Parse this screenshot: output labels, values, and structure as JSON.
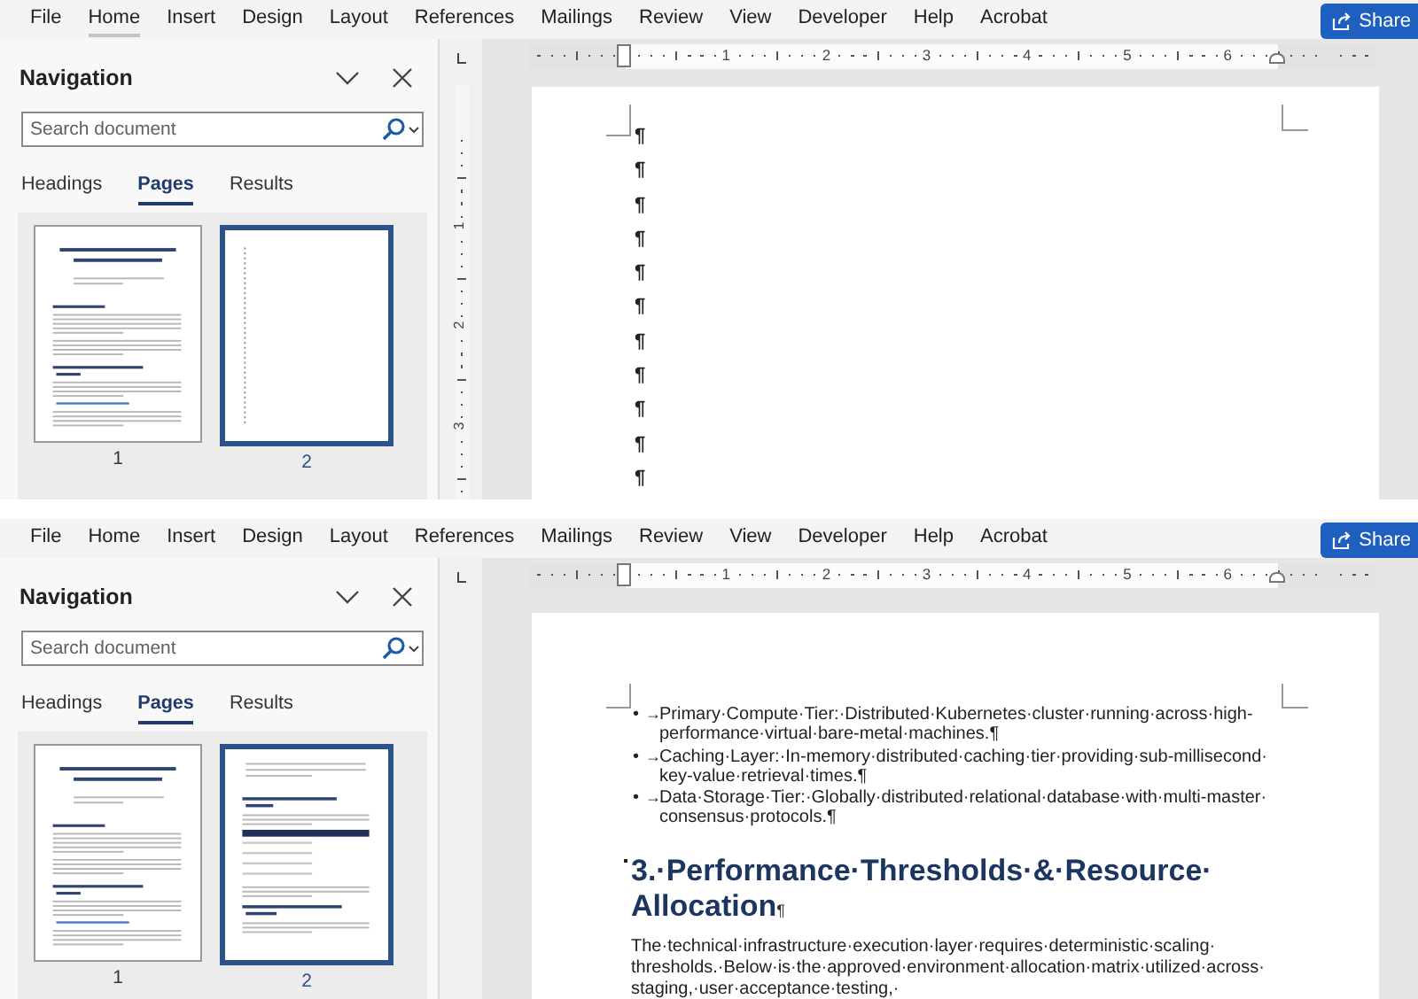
{
  "panels": [
    {
      "menu": [
        {
          "label": "File",
          "selected": false
        },
        {
          "label": "Home",
          "selected": true
        },
        {
          "label": "Insert",
          "selected": false
        },
        {
          "label": "Design",
          "selected": false
        },
        {
          "label": "Layout",
          "selected": false
        },
        {
          "label": "References",
          "selected": false
        },
        {
          "label": "Mailings",
          "selected": false
        },
        {
          "label": "Review",
          "selected": false
        },
        {
          "label": "View",
          "selected": false
        },
        {
          "label": "Developer",
          "selected": false
        },
        {
          "label": "Help",
          "selected": false
        },
        {
          "label": "Acrobat",
          "selected": false
        }
      ],
      "share_button": "Share",
      "navigation": {
        "title": "Navigation",
        "search": {
          "placeholder": "Search document"
        },
        "tabs": [
          {
            "label": "Headings",
            "selected": false
          },
          {
            "label": "Pages",
            "selected": true
          },
          {
            "label": "Results",
            "selected": false
          }
        ],
        "thumbnails": [
          {
            "page": "1",
            "kind": "title-page",
            "selected": false
          },
          {
            "page": "2",
            "kind": "empty-lines",
            "selected": true
          }
        ]
      },
      "horizontal_ruler": [
        "1",
        "2",
        "3",
        "4",
        "5",
        "6"
      ],
      "vertical_ruler": [
        "1",
        "2",
        "3"
      ],
      "document": {
        "scrolled": true,
        "paragraphs": [
          {
            "kind": "empty",
            "text": "¶"
          },
          {
            "kind": "empty",
            "text": "¶"
          },
          {
            "kind": "empty",
            "text": "¶"
          },
          {
            "kind": "empty",
            "text": "¶"
          },
          {
            "kind": "empty",
            "text": "¶"
          },
          {
            "kind": "empty",
            "text": "¶"
          },
          {
            "kind": "empty",
            "text": "¶"
          },
          {
            "kind": "empty",
            "text": "¶"
          },
          {
            "kind": "empty",
            "text": "¶"
          },
          {
            "kind": "empty",
            "text": "¶"
          },
          {
            "kind": "empty",
            "text": "¶"
          }
        ]
      }
    },
    {
      "menu": [
        {
          "label": "File",
          "selected": false
        },
        {
          "label": "Home",
          "selected": false
        },
        {
          "label": "Insert",
          "selected": false
        },
        {
          "label": "Design",
          "selected": false
        },
        {
          "label": "Layout",
          "selected": false
        },
        {
          "label": "References",
          "selected": false
        },
        {
          "label": "Mailings",
          "selected": false
        },
        {
          "label": "Review",
          "selected": false
        },
        {
          "label": "View",
          "selected": false
        },
        {
          "label": "Developer",
          "selected": false
        },
        {
          "label": "Help",
          "selected": false
        },
        {
          "label": "Acrobat",
          "selected": false
        }
      ],
      "share_button": "Share",
      "navigation": {
        "title": "Navigation",
        "search": {
          "placeholder": "Search document"
        },
        "tabs": [
          {
            "label": "Headings",
            "selected": false
          },
          {
            "label": "Pages",
            "selected": true
          },
          {
            "label": "Results",
            "selected": false
          }
        ],
        "thumbnails": [
          {
            "page": "1",
            "kind": "title-page",
            "selected": false
          },
          {
            "page": "2",
            "kind": "body",
            "selected": true
          }
        ]
      },
      "horizontal_ruler": [
        "1",
        "2",
        "3",
        "4",
        "5",
        "6"
      ],
      "document": {
        "scrolled": false,
        "paragraphs": [
          {
            "kind": "bullet",
            "marker": "•",
            "tab": "→",
            "text": "Primary·Compute·Tier:·Distributed·Kubernetes·cluster·running·across·high-performance·virtual·bare-metal·machines.¶"
          },
          {
            "kind": "bullet",
            "marker": "•",
            "tab": "→",
            "text": "Caching·Layer:·In-memory·distributed·caching·tier·providing·sub-millisecond·key-value·retrieval·times.¶"
          },
          {
            "kind": "bullet",
            "marker": "•",
            "tab": "→",
            "text": "Data·Storage·Tier:·Globally·distributed·relational·database·with·multi-master·consensus·protocols.¶"
          },
          {
            "kind": "heading",
            "text": "3.·Performance·Thresholds·&·Resource·Allocation$_{¶}$"
          },
          {
            "kind": "body",
            "text": "The·technical·infrastructure·execution·layer·requires·deterministic·scaling·thresholds.·Below·is·the·approved·environment·allocation·matrix·utilized·across·staging,·user·acceptance·testing,·"
          }
        ]
      }
    }
  ]
}
